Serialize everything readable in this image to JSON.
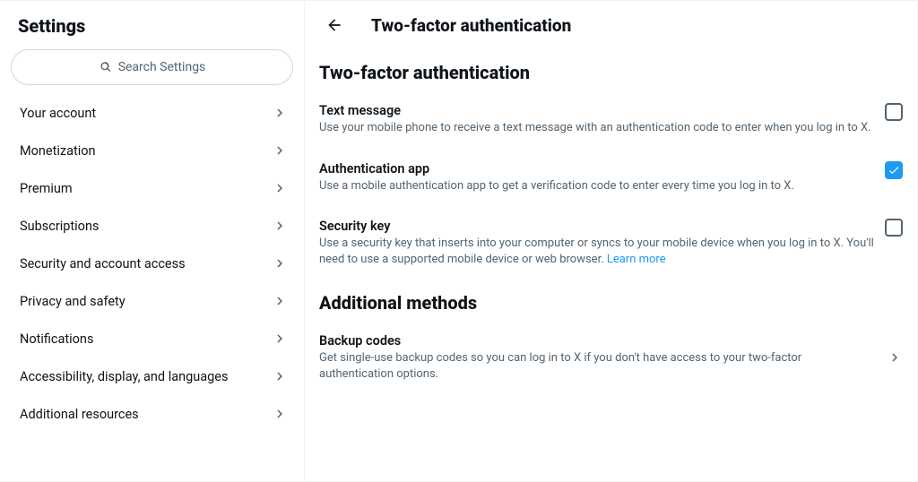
{
  "sidebar": {
    "title": "Settings",
    "search_placeholder": "Search Settings",
    "items": [
      {
        "label": "Your account"
      },
      {
        "label": "Monetization"
      },
      {
        "label": "Premium"
      },
      {
        "label": "Subscriptions"
      },
      {
        "label": "Security and account access"
      },
      {
        "label": "Privacy and safety"
      },
      {
        "label": "Notifications"
      },
      {
        "label": "Accessibility, display, and languages"
      },
      {
        "label": "Additional resources"
      }
    ]
  },
  "main": {
    "page_title": "Two-factor authentication",
    "section1_heading": "Two-factor authentication",
    "methods": [
      {
        "title": "Text message",
        "desc": "Use your mobile phone to receive a text message with an authentication code to enter when you log in to X.",
        "checked": false
      },
      {
        "title": "Authentication app",
        "desc": "Use a mobile authentication app to get a verification code to enter every time you log in to X.",
        "checked": true
      },
      {
        "title": "Security key",
        "desc": "Use a security key that inserts into your computer or syncs to your mobile device when you log in to X. You'll need to use a supported mobile device or web browser. ",
        "link": "Learn more",
        "checked": false
      }
    ],
    "section2_heading": "Additional methods",
    "backup": {
      "title": "Backup codes",
      "desc": "Get single-use backup codes so you can log in to X if you don't have access to your two-factor authentication options."
    }
  }
}
